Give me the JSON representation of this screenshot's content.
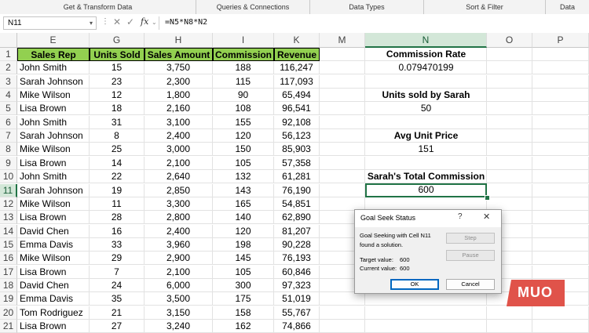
{
  "ribbon": {
    "groups": [
      "Get & Transform Data",
      "Queries & Connections",
      "Data Types",
      "Sort & Filter",
      "Data"
    ]
  },
  "formula_bar": {
    "name_box": "N11",
    "formula": "=N5*N8*N2"
  },
  "column_headers": [
    "E",
    "G",
    "H",
    "I",
    "K",
    "M",
    "N",
    "O",
    "P"
  ],
  "row_numbers": [
    "1",
    "2",
    "3",
    "4",
    "5",
    "6",
    "7",
    "8",
    "9",
    "10",
    "11",
    "12",
    "13",
    "14",
    "15",
    "16",
    "17",
    "18",
    "19",
    "20",
    "21"
  ],
  "table": {
    "headers": [
      "Sales Rep",
      "Units Sold",
      "Sales Amount",
      "Commission",
      "Revenue"
    ],
    "rows": [
      [
        "John Smith",
        "15",
        "3,750",
        "188",
        "116,247"
      ],
      [
        "Sarah Johnson",
        "23",
        "2,300",
        "115",
        "117,093"
      ],
      [
        "Mike Wilson",
        "12",
        "1,800",
        "90",
        "65,494"
      ],
      [
        "Lisa Brown",
        "18",
        "2,160",
        "108",
        "96,541"
      ],
      [
        "John Smith",
        "31",
        "3,100",
        "155",
        "92,108"
      ],
      [
        "Sarah Johnson",
        "8",
        "2,400",
        "120",
        "56,123"
      ],
      [
        "Mike Wilson",
        "25",
        "3,000",
        "150",
        "85,903"
      ],
      [
        "Lisa Brown",
        "14",
        "2,100",
        "105",
        "57,358"
      ],
      [
        "John Smith",
        "22",
        "2,640",
        "132",
        "61,281"
      ],
      [
        "Sarah Johnson",
        "19",
        "2,850",
        "143",
        "76,190"
      ],
      [
        "Mike Wilson",
        "11",
        "3,300",
        "165",
        "54,851"
      ],
      [
        "Lisa Brown",
        "28",
        "2,800",
        "140",
        "62,890"
      ],
      [
        "David Chen",
        "16",
        "2,400",
        "120",
        "81,207"
      ],
      [
        "Emma Davis",
        "33",
        "3,960",
        "198",
        "90,228"
      ],
      [
        "Mike Wilson",
        "29",
        "2,900",
        "145",
        "76,193"
      ],
      [
        "Lisa Brown",
        "7",
        "2,100",
        "105",
        "60,846"
      ],
      [
        "David Chen",
        "24",
        "6,000",
        "300",
        "97,323"
      ],
      [
        "Emma Davis",
        "35",
        "3,500",
        "175",
        "51,019"
      ],
      [
        "Tom Rodriguez",
        "21",
        "3,150",
        "158",
        "55,767"
      ],
      [
        "Lisa Brown",
        "27",
        "3,240",
        "162",
        "74,866"
      ]
    ]
  },
  "side_panel": {
    "commission_rate_label": "Commission Rate",
    "commission_rate_value": "0.079470199",
    "units_sarah_label": "Units sold by Sarah",
    "units_sarah_value": "50",
    "avg_price_label": "Avg Unit Price",
    "avg_price_value": "151",
    "total_commission_label": "Sarah's Total Commission",
    "total_commission_value": "600"
  },
  "dialog": {
    "title": "Goal Seek Status",
    "help": "?",
    "close": "✕",
    "message_line1": "Goal Seeking with Cell N11",
    "message_line2": "found a solution.",
    "target_label": "Target value:",
    "target_value": "600",
    "current_label": "Current value:",
    "current_value": "600",
    "step_label": "Step",
    "pause_label": "Pause",
    "ok_label": "OK",
    "cancel_label": "Cancel"
  },
  "watermark": {
    "text": "MUO"
  },
  "colors": {
    "header_fill": "#92d050",
    "excel_green": "#217346",
    "selected_header": "#d3e7d8",
    "watermark": "#e0534a"
  }
}
